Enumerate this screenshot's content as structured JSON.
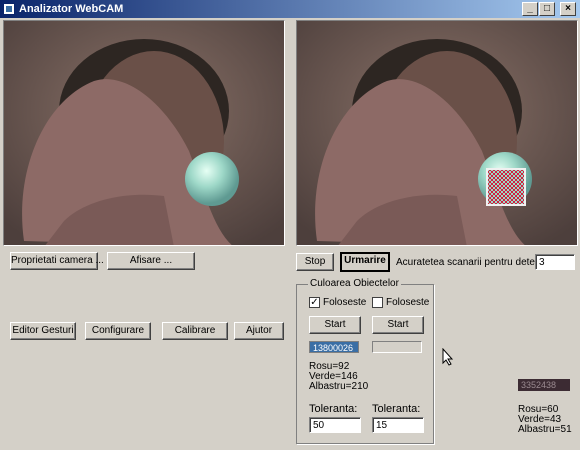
{
  "window": {
    "title": "Analizator WebCAM",
    "controls": {
      "minimize": "_",
      "maximize": "□",
      "close": "×"
    }
  },
  "buttons": {
    "camera_props": "Proprietati camera ...",
    "display": "Afisare ...",
    "stop": "Stop",
    "track": "Urmarire",
    "gesture_editor": "Editor Gesturi",
    "configure": "Configurare",
    "calibrate": "Calibrare",
    "help": "Ajutor"
  },
  "scan": {
    "label": "Acuratetea scanarii pentru detectie",
    "value": "3"
  },
  "colors_group": {
    "title": "Culoarea Obiectelor",
    "obj1": {
      "use_label": "Foloseste",
      "checked": true,
      "start": "Start",
      "code": "13800026",
      "rosu": "Rosu=92",
      "verde": "Verde=146",
      "albastru": "Albastru=210",
      "tol_label": "Toleranta:",
      "tol_value": "50"
    },
    "obj2": {
      "use_label": "Foloseste",
      "checked": false,
      "start": "Start",
      "code": "",
      "tol_label": "Toleranta:",
      "tol_value": "15"
    }
  },
  "right_panel": {
    "code": "3352438",
    "rosu": "Rosu=60",
    "verde": "Verde=43",
    "albastru": "Albastru=51"
  },
  "colors": {
    "titlebar_start": "#0a246a",
    "highlight": "#3a6ea5",
    "tracking_box": "#f0f0f0",
    "tracking_fill": "#d02040"
  }
}
